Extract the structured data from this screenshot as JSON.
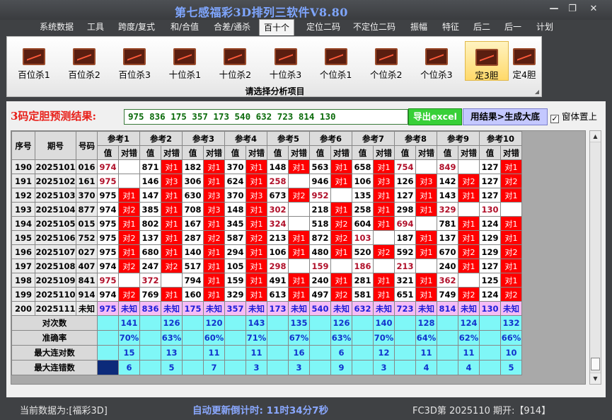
{
  "window": {
    "title": "第七感福彩3D排列三软件V8.80",
    "minimize": "—",
    "restore": "❐",
    "close": "✕"
  },
  "menu": [
    {
      "label": "系统数据",
      "active": false
    },
    {
      "label": "工具",
      "active": false
    },
    {
      "label": "跨度/复式",
      "active": false
    },
    {
      "label": "和/合值",
      "active": false
    },
    {
      "label": "合差/通杀",
      "active": false
    },
    {
      "label": "百十个",
      "active": true
    },
    {
      "label": "定位二码",
      "active": false
    },
    {
      "label": "不定位二码",
      "active": false
    },
    {
      "label": "振幅",
      "active": false
    },
    {
      "label": "特征",
      "active": false
    },
    {
      "label": "后二",
      "active": false
    },
    {
      "label": "后一",
      "active": false
    },
    {
      "label": "计划",
      "active": false
    }
  ],
  "ribbon": {
    "caption": "请选择分析项目",
    "buttons": [
      {
        "label": "百位杀1",
        "active": false
      },
      {
        "label": "百位杀2",
        "active": false
      },
      {
        "label": "百位杀3",
        "active": false
      },
      {
        "label": "十位杀1",
        "active": false
      },
      {
        "label": "十位杀2",
        "active": false
      },
      {
        "label": "十位杀3",
        "active": false
      },
      {
        "label": "个位杀1",
        "active": false
      },
      {
        "label": "个位杀2",
        "active": false
      },
      {
        "label": "个位杀3",
        "active": false
      },
      {
        "label": "定3胆",
        "active": true
      },
      {
        "label": "定4胆",
        "active": false
      }
    ]
  },
  "prediction": {
    "label": "3码定胆预测结果:",
    "value": "975 836 175 357 173 540 632 723 814 130",
    "export_label": "导出excel",
    "dict_label": "用结果>生成大底",
    "topmost_label": "窗体置上",
    "topmost_checked": true
  },
  "table": {
    "headers": {
      "seq": "序号",
      "issue": "期号",
      "code": "号码",
      "ref_value": "值",
      "ref_result": "对错"
    },
    "refs": [
      "参考1",
      "参考2",
      "参考3",
      "参考4",
      "参考5",
      "参考6",
      "参考7",
      "参考8",
      "参考9",
      "参考10"
    ],
    "hit_text": "对1",
    "rows": [
      {
        "seq": "190",
        "issue": "2025101",
        "code": "016",
        "cells": [
          [
            "974",
            ""
          ],
          [
            "871",
            "对1"
          ],
          [
            "182",
            "对1"
          ],
          [
            "370",
            "对1"
          ],
          [
            "148",
            "对1"
          ],
          [
            "563",
            "对1"
          ],
          [
            "658",
            "对1"
          ],
          [
            "754",
            ""
          ],
          [
            "849",
            ""
          ],
          [
            "127",
            "对1"
          ]
        ]
      },
      {
        "seq": "191",
        "issue": "2025102",
        "code": "161",
        "cells": [
          [
            "975",
            ""
          ],
          [
            "146",
            "对3"
          ],
          [
            "306",
            "对1"
          ],
          [
            "624",
            "对1"
          ],
          [
            "258",
            ""
          ],
          [
            "946",
            "对1"
          ],
          [
            "106",
            "对3"
          ],
          [
            "126",
            "对3"
          ],
          [
            "142",
            "对2"
          ],
          [
            "127",
            "对2"
          ]
        ]
      },
      {
        "seq": "192",
        "issue": "2025103",
        "code": "370",
        "cells": [
          [
            "975",
            "对1"
          ],
          [
            "147",
            "对1"
          ],
          [
            "630",
            "对3"
          ],
          [
            "370",
            "对3"
          ],
          [
            "673",
            "对2"
          ],
          [
            "952",
            ""
          ],
          [
            "135",
            "对1"
          ],
          [
            "127",
            "对1"
          ],
          [
            "143",
            "对1"
          ],
          [
            "127",
            "对1"
          ]
        ]
      },
      {
        "seq": "193",
        "issue": "2025104",
        "code": "877",
        "cells": [
          [
            "974",
            "对2"
          ],
          [
            "385",
            "对1"
          ],
          [
            "708",
            "对3"
          ],
          [
            "148",
            "对1"
          ],
          [
            "302",
            ""
          ],
          [
            "218",
            "对1"
          ],
          [
            "258",
            "对1"
          ],
          [
            "298",
            "对1"
          ],
          [
            "329",
            ""
          ],
          [
            "130",
            ""
          ]
        ]
      },
      {
        "seq": "194",
        "issue": "2025105",
        "code": "015",
        "cells": [
          [
            "975",
            "对1"
          ],
          [
            "802",
            "对1"
          ],
          [
            "167",
            "对1"
          ],
          [
            "345",
            "对1"
          ],
          [
            "324",
            ""
          ],
          [
            "518",
            "对2"
          ],
          [
            "604",
            "对1"
          ],
          [
            "694",
            ""
          ],
          [
            "781",
            "对1"
          ],
          [
            "124",
            "对1"
          ]
        ]
      },
      {
        "seq": "195",
        "issue": "2025106",
        "code": "752",
        "cells": [
          [
            "975",
            "对2"
          ],
          [
            "137",
            "对1"
          ],
          [
            "287",
            "对2"
          ],
          [
            "587",
            "对2"
          ],
          [
            "213",
            "对1"
          ],
          [
            "872",
            "对2"
          ],
          [
            "103",
            ""
          ],
          [
            "187",
            "对1"
          ],
          [
            "137",
            "对1"
          ],
          [
            "129",
            "对1"
          ]
        ]
      },
      {
        "seq": "196",
        "issue": "2025107",
        "code": "027",
        "cells": [
          [
            "975",
            "对1"
          ],
          [
            "680",
            "对1"
          ],
          [
            "140",
            "对1"
          ],
          [
            "294",
            "对1"
          ],
          [
            "106",
            "对1"
          ],
          [
            "480",
            "对1"
          ],
          [
            "520",
            "对2"
          ],
          [
            "592",
            "对1"
          ],
          [
            "670",
            "对2"
          ],
          [
            "129",
            "对2"
          ]
        ]
      },
      {
        "seq": "197",
        "issue": "2025108",
        "code": "407",
        "cells": [
          [
            "974",
            "对2"
          ],
          [
            "247",
            "对2"
          ],
          [
            "517",
            "对1"
          ],
          [
            "105",
            "对1"
          ],
          [
            "298",
            ""
          ],
          [
            "159",
            ""
          ],
          [
            "186",
            ""
          ],
          [
            "213",
            ""
          ],
          [
            "240",
            "对1"
          ],
          [
            "127",
            "对1"
          ]
        ]
      },
      {
        "seq": "198",
        "issue": "2025109",
        "code": "841",
        "cells": [
          [
            "975",
            ""
          ],
          [
            "372",
            ""
          ],
          [
            "794",
            "对1"
          ],
          [
            "159",
            "对1"
          ],
          [
            "491",
            "对1"
          ],
          [
            "240",
            "对1"
          ],
          [
            "281",
            "对1"
          ],
          [
            "321",
            "对1"
          ],
          [
            "362",
            ""
          ],
          [
            "125",
            "对1"
          ]
        ]
      },
      {
        "seq": "199",
        "issue": "2025110",
        "code": "914",
        "cells": [
          [
            "974",
            "对2"
          ],
          [
            "769",
            "对1"
          ],
          [
            "160",
            "对1"
          ],
          [
            "329",
            "对1"
          ],
          [
            "613",
            "对1"
          ],
          [
            "497",
            "对2"
          ],
          [
            "581",
            "对1"
          ],
          [
            "651",
            "对1"
          ],
          [
            "749",
            "对2"
          ],
          [
            "124",
            "对2"
          ]
        ]
      }
    ],
    "pending": {
      "seq": "200",
      "issue": "2025111",
      "code": "未知",
      "cells": [
        [
          "975",
          "未知"
        ],
        [
          "836",
          "未知"
        ],
        [
          "175",
          "未知"
        ],
        [
          "357",
          "未知"
        ],
        [
          "173",
          "未知"
        ],
        [
          "540",
          "未知"
        ],
        [
          "632",
          "未知"
        ],
        [
          "723",
          "未知"
        ],
        [
          "814",
          "未知"
        ],
        [
          "130",
          "未知"
        ]
      ]
    },
    "stats": [
      {
        "label": "对次数",
        "values": [
          "141",
          "126",
          "120",
          "143",
          "135",
          "126",
          "140",
          "128",
          "124",
          "132"
        ]
      },
      {
        "label": "准确率",
        "values": [
          "70%",
          "63%",
          "60%",
          "71%",
          "67%",
          "63%",
          "70%",
          "64%",
          "62%",
          "66%"
        ]
      },
      {
        "label": "最大连对数",
        "values": [
          "15",
          "13",
          "11",
          "11",
          "16",
          "6",
          "12",
          "11",
          "11",
          "10"
        ]
      },
      {
        "label": "最大连错数",
        "values": [
          "6",
          "5",
          "7",
          "3",
          "3",
          "9",
          "3",
          "4",
          "4",
          "5"
        ]
      }
    ]
  },
  "statusbar": {
    "data_label": "当前数据为:[福彩3D]",
    "update_label": "自动更新倒计时:  11时34分7秒",
    "issue_label": "FC3D第 2025110 期开:【914】"
  },
  "colors": {
    "hit_bg": "#ff0000",
    "pending_bg": "#f5bcf5",
    "stat_bg": "#7ff7f7",
    "prediction_text": "#0a6a0a",
    "title_text": "#7fa6ff"
  }
}
